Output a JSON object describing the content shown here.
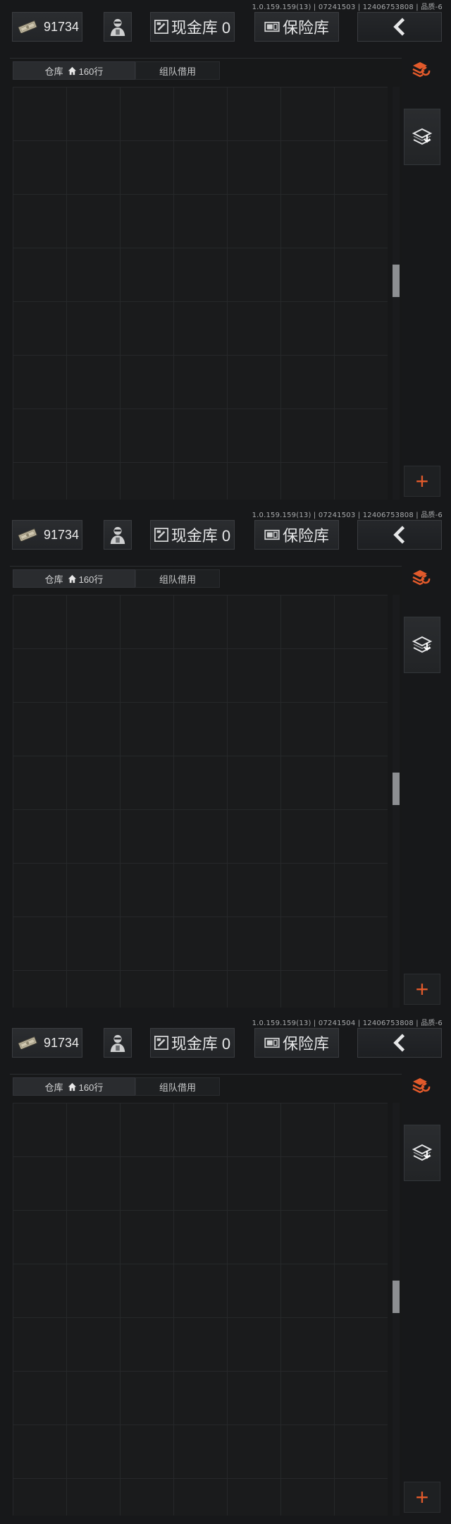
{
  "panels": [
    {
      "version": "1.0.159.159(13) | 07241503 | 12406753808 | 品质-6",
      "money": "91734",
      "cash_label": "现金库 0",
      "safe_label": "保险库",
      "tab_warehouse": "仓库",
      "tab_rows": "160行",
      "tab_team": "组队借用",
      "plus": "+"
    },
    {
      "version": "1.0.159.159(13) | 07241503 | 12406753808 | 品质-6",
      "money": "91734",
      "cash_label": "现金库 0",
      "safe_label": "保险库",
      "tab_warehouse": "仓库",
      "tab_rows": "160行",
      "tab_team": "组队借用",
      "plus": "+"
    },
    {
      "version": "1.0.159.159(13) | 07241504 | 12406753808 | 品质-6",
      "money": "91734",
      "cash_label": "现金库 0",
      "safe_label": "保险库",
      "tab_warehouse": "仓库",
      "tab_rows": "160行",
      "tab_team": "组队借用",
      "plus": "+"
    }
  ],
  "icons": {
    "money": "banknote-icon",
    "agent": "operator-avatar-icon",
    "cash": "cash-box-icon",
    "safe": "safe-box-icon",
    "back": "chevron-left-icon",
    "refresh": "sort-refresh-icon",
    "stack": "stack-download-icon",
    "home": "home-icon"
  },
  "colors": {
    "accent": "#e25a2b",
    "background": "#17181a",
    "grid_line": "#26282a"
  }
}
